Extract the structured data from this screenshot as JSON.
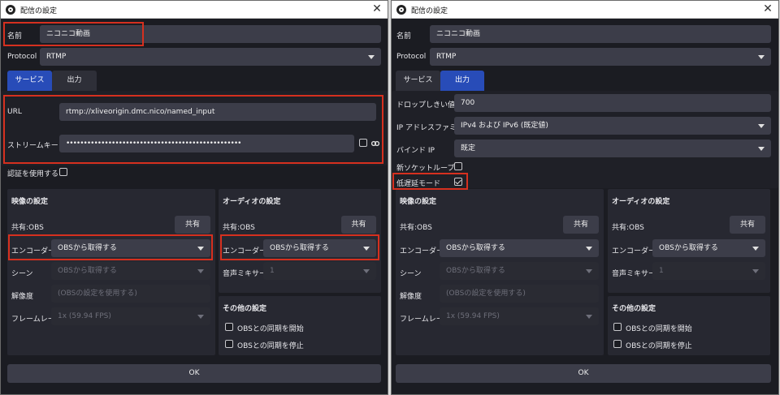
{
  "window_title": "配信の設定",
  "left": {
    "name_label": "名前",
    "name_value": "ニコニコ動画",
    "protocol_label": "Protocol",
    "protocol_value": "RTMP",
    "tabs": [
      {
        "label": "サービス",
        "active": true
      },
      {
        "label": "出力",
        "active": false
      }
    ],
    "url_label": "URL",
    "url_value": "rtmp://xliveorigin.dmc.nico/named_input",
    "streamkey_label": "ストリームキー",
    "streamkey_value": "••••••••••••••••••••••••••••••••••••••••••••••••••",
    "auth_label": "認証を使用する",
    "video": {
      "title": "映像の設定",
      "shared_label": "共有:OBS",
      "shared_button": "共有",
      "encoder_label": "エンコーダー",
      "encoder_value": "OBSから取得する",
      "scene_label": "シーン",
      "scene_value": "OBSから取得する",
      "resolution_label": "解像度",
      "resolution_placeholder": "(OBSの設定を使用する)",
      "framerate_label": "フレームレート",
      "framerate_value": "1x (59.94 FPS)"
    },
    "audio": {
      "title": "オーディオの設定",
      "shared_label": "共有:OBS",
      "shared_button": "共有",
      "encoder_label": "エンコーダー",
      "encoder_value": "OBSから取得する",
      "mixer_label": "音声ミキサー",
      "mixer_value": "1"
    },
    "other": {
      "title": "その他の設定",
      "sync_start": "OBSとの同期を開始",
      "sync_stop": "OBSとの同期を停止"
    },
    "ok_button": "OK"
  },
  "right": {
    "name_label": "名前",
    "name_value": "ニコニコ動画",
    "protocol_label": "Protocol",
    "protocol_value": "RTMP",
    "tabs": [
      {
        "label": "サービス",
        "active": false
      },
      {
        "label": "出力",
        "active": true
      }
    ],
    "drop_label": "ドロップしきい値",
    "drop_value": "700",
    "ipfamily_label": "IP アドレスファミリー",
    "ipfamily_value": "IPv4 および IPv6 (既定値)",
    "bindip_label": "バインド IP",
    "bindip_value": "既定",
    "socketloop_label": "新ソケットループ",
    "lowlatency_label": "低遅延モード",
    "lowlatency_checked": true,
    "video": {
      "title": "映像の設定",
      "shared_label": "共有:OBS",
      "shared_button": "共有",
      "encoder_label": "エンコーダー",
      "encoder_value": "OBSから取得する",
      "scene_label": "シーン",
      "scene_value": "OBSから取得する",
      "resolution_label": "解像度",
      "resolution_placeholder": "(OBSの設定を使用する)",
      "framerate_label": "フレームレート",
      "framerate_value": "1x (59.94 FPS)"
    },
    "audio": {
      "title": "オーディオの設定",
      "shared_label": "共有:OBS",
      "shared_button": "共有",
      "encoder_label": "エンコーダー",
      "encoder_value": "OBSから取得する",
      "mixer_label": "音声ミキサー",
      "mixer_value": "1"
    },
    "other": {
      "title": "その他の設定",
      "sync_start": "OBSとの同期を開始",
      "sync_stop": "OBSとの同期を停止"
    },
    "ok_button": "OK"
  },
  "highlight_color": "#d6301f",
  "accent_color": "#284cb8"
}
